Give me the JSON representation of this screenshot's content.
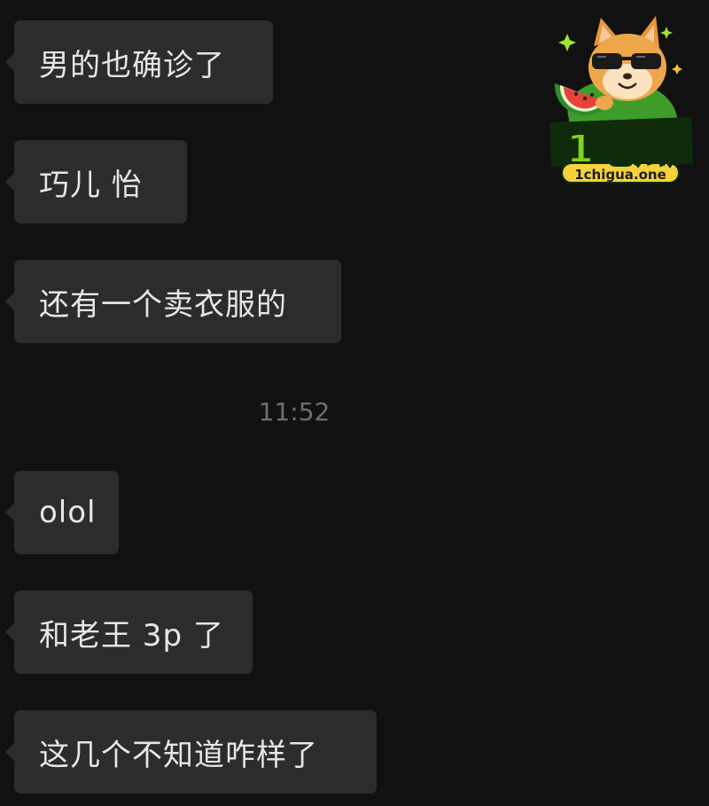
{
  "messages": [
    {
      "text": "男的也确诊了"
    },
    {
      "text": "巧儿 怡"
    },
    {
      "text": "还有一个卖衣服的"
    },
    {
      "text": "olol"
    },
    {
      "text": "和老王 3p 了"
    },
    {
      "text": "这几个不知道咋样了"
    }
  ],
  "timestamp": "11:52",
  "watermark": {
    "title": "1吃瓜",
    "domain": "1chigua.one"
  },
  "colors": {
    "background": "#111111",
    "bubble": "#2c2c2c",
    "text": "#e6e6e6",
    "timestamp": "#6f6f6f",
    "logo_green": "#7fd21d"
  }
}
